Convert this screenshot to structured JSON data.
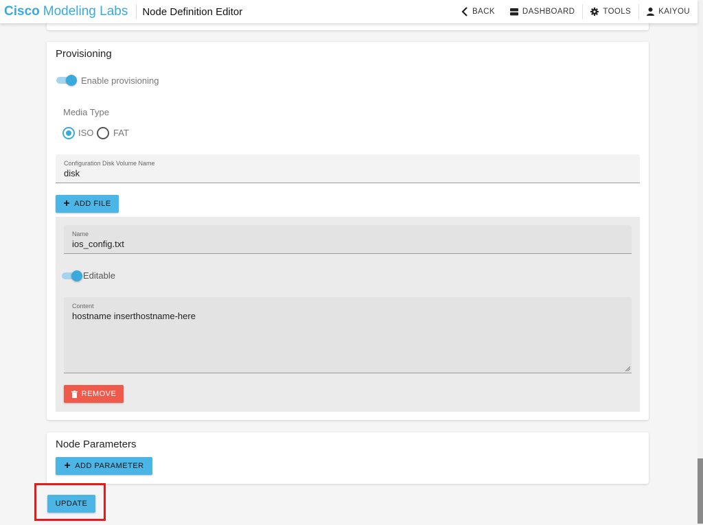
{
  "header": {
    "brand_cisco": "Cisco",
    "brand_rest": "Modeling Labs",
    "page_title": "Node Definition Editor",
    "nav": {
      "back": "BACK",
      "dashboard": "DASHBOARD",
      "tools": "TOOLS",
      "user": "KAIYOU"
    }
  },
  "provisioning": {
    "title": "Provisioning",
    "enable_label": "Enable provisioning",
    "enabled": true,
    "media_type_label": "Media Type",
    "media_options": [
      "ISO",
      "FAT"
    ],
    "media_selected": "ISO",
    "volume_name_label": "Configuration Disk Volume Name",
    "volume_name_value": "disk",
    "add_file_label": "ADD FILE",
    "file": {
      "name_label": "Name",
      "name_value": "ios_config.txt",
      "editable_label": "Editable",
      "editable": true,
      "content_label": "Content",
      "content_value": "hostname inserthostname-here",
      "remove_label": "REMOVE"
    }
  },
  "node_parameters": {
    "title": "Node Parameters",
    "add_parameter_label": "ADD PARAMETER"
  },
  "update_label": "UPDATE",
  "colors": {
    "accent": "#3aa9dc",
    "button": "#4bb5e6",
    "danger": "#ef5a4a",
    "highlight": "#e21c1c"
  }
}
